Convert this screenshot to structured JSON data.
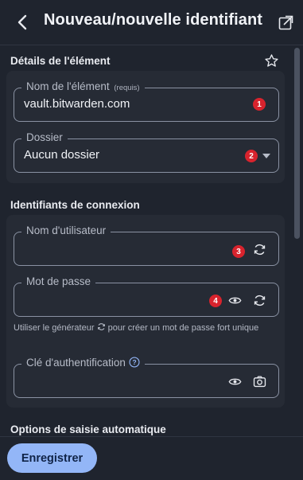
{
  "header": {
    "title": "Nouveau/nouvelle identifiant"
  },
  "item_details": {
    "section_title": "Détails de l'élément",
    "name": {
      "label": "Nom de l'élément",
      "required_tag": "(requis)",
      "value": "vault.bitwarden.com",
      "badge": "1"
    },
    "folder": {
      "label": "Dossier",
      "value": "Aucun dossier",
      "badge": "2"
    }
  },
  "login": {
    "section_title": "Identifiants de connexion",
    "username": {
      "label": "Nom d'utilisateur",
      "value": "",
      "badge": "3"
    },
    "password": {
      "label": "Mot de passe",
      "value": "",
      "badge": "4"
    },
    "hint_before": "Utiliser le générateur",
    "hint_after": "pour créer un mot de passe fort unique",
    "authenticator": {
      "label": "Clé d'authentification",
      "value": ""
    }
  },
  "autofill": {
    "section_title": "Options de saisie automatique"
  },
  "footer": {
    "save_label": "Enregistrer"
  },
  "colors": {
    "accent": "#93b6f7",
    "badge": "#d8232d",
    "background": "#1f242e",
    "card": "#262b35"
  }
}
